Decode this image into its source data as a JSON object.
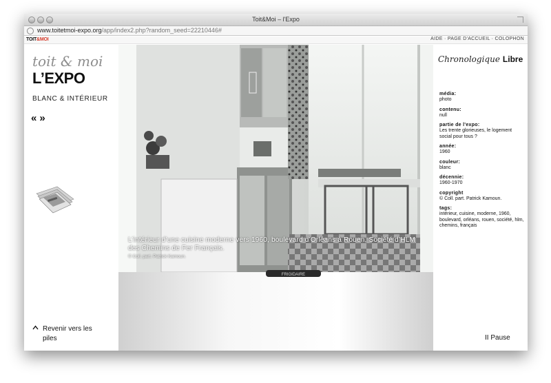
{
  "window": {
    "title": "Toit&Moi – l'Expo",
    "url_host": "www.toitetmoi-expo.org",
    "url_path": "/app/index2.php?random_seed=22210446#"
  },
  "site_logo": {
    "prefix": "TOIT",
    "amp": "&",
    "suffix": "MOI"
  },
  "topnav": {
    "aide": "AIDE",
    "sep1": " · ",
    "accueil": "PAGE D'ACCUEIL",
    "sep2": " · ",
    "colophon": "COLOPHON"
  },
  "left": {
    "logo_top": "toit & moi",
    "logo_main": "L’EXPO",
    "subtitle": "BLANC & INTÉRIEUR",
    "prev": "«",
    "next": "»",
    "back_chevron": "^",
    "back_label": "Revenir vers les piles"
  },
  "photo": {
    "caption": "L’intérieur d’une cuisine moderne vers 1960, boulevard d’Orléans à Rouen, Société d’HLM des Chemins de Fer Français.",
    "credit": "© Coll. part. Patrick Kamoun.",
    "fridge_brand": "FRIGIDAIRE"
  },
  "right": {
    "mode_chrono": "Chronologique",
    "mode_libre": "Libre",
    "meta": [
      {
        "label": "média:",
        "value": "photo"
      },
      {
        "label": "contenu:",
        "value": "null"
      },
      {
        "label": "partie de l'expo:",
        "value": "Les trente glorieuses, le logement social pour tous ?"
      },
      {
        "label": "année:",
        "value": "1960"
      },
      {
        "label": "couleur:",
        "value": "blanc"
      },
      {
        "label": "décennie:",
        "value": "1960-1970"
      },
      {
        "label": "copyright",
        "value": "© Coll. part. Patrick Kamoun."
      },
      {
        "label": "tags:",
        "value": "intérieur, cuisine, moderne, 1960, boulevard, orléans, rouen, société, hlm, chemins, français"
      }
    ],
    "pause": "II Pause"
  },
  "colors": {
    "accent": "#d43a2a",
    "text": "#111111",
    "muted": "#8e8e8e"
  }
}
